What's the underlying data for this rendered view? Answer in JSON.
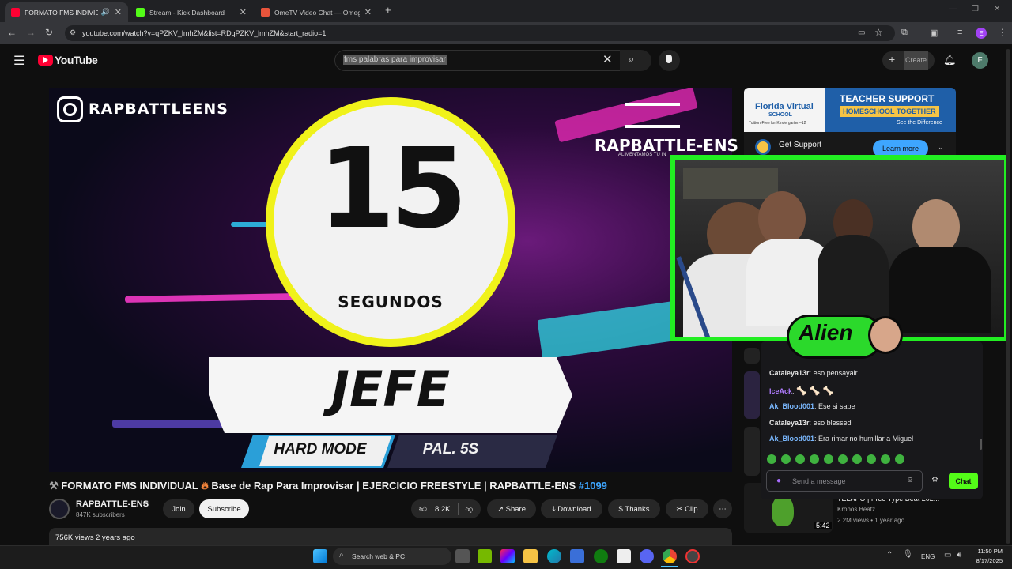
{
  "browser": {
    "tabs": [
      {
        "label": "FORMATO FMS INDIVIDUAL",
        "active": true
      },
      {
        "label": "Stream - Kick Dashboard",
        "active": false
      },
      {
        "label": "OmeTV Video Chat — Omegle",
        "active": false
      }
    ],
    "url": "youtube.com/watch?v=qPZKV_lmhZM&list=RDqPZKV_lmhZM&start_radio=1",
    "profile_initial": "E"
  },
  "youtube": {
    "logo": "YouTube",
    "search_query": "fms palabras para improvisar",
    "create_label": "Create",
    "avatar_initial": "F"
  },
  "video_frame": {
    "ig_handle": "RAPBATTLEENS",
    "brand": "RAPBATTLE-ENS",
    "brand_tagline": "ALIMENTAMOS TU IN",
    "timer": "15",
    "timer_unit": "SEGUNDOS",
    "word": "JEFE",
    "mode": "HARD MODE",
    "interval": "PAL. 5S"
  },
  "video": {
    "title_prefix": "FORMATO FMS INDIVIDUAL",
    "title_middle": "Base de Rap Para Improvisar | EJERCICIO FREESTYLE | RAPBATTLE-ENS",
    "title_tag": "#1099",
    "channel": "RAPBATTLE-ENS",
    "subscribers": "847K subscribers",
    "join": "Join",
    "subscribe": "Subscribe",
    "likes": "8.2K",
    "share": "Share",
    "download": "Download",
    "thanks": "Thanks",
    "clip": "Clip",
    "views": "756K views",
    "age": "2 years ago"
  },
  "ad": {
    "school": "Florida Virtual",
    "school2": "SCHOOL",
    "tuition": "Tuition-Free for Kindergarten–12",
    "headline": "TEACHER SUPPORT",
    "sub": "HOMESCHOOL TOGETHER",
    "cta": "See the Difference",
    "get_support": "Get Support",
    "learn_more": "Learn more"
  },
  "chat": {
    "messages": [
      {
        "user": "Cataleya13r",
        "text": "eso pensayair",
        "color": "#e6e6e6"
      },
      {
        "user": "IceAck",
        "text": "",
        "color": "#b07cff"
      },
      {
        "user": "Ak_Blood001",
        "text": "Ese si sabe",
        "color": "#7ab8ff"
      },
      {
        "user": "Cataleya13r",
        "text": "eso blessed",
        "color": "#e6e6e6"
      },
      {
        "user": "Ak_Blood001",
        "text": "Era rimar no humillar a Miguel",
        "color": "#7ab8ff"
      }
    ],
    "placeholder": "Send a message",
    "send": "Chat",
    "sticker": "Alien"
  },
  "related": [
    {
      "title": "TELAPO | Free Type Beat 202...",
      "channel": "Kronos Beatz",
      "meta": "2.2M views • 1 year ago",
      "duration": "5:42"
    }
  ],
  "taskbar": {
    "search": "Search web & PC",
    "lang": "ENG",
    "time": "11:50 PM",
    "date": "8/17/2025"
  }
}
